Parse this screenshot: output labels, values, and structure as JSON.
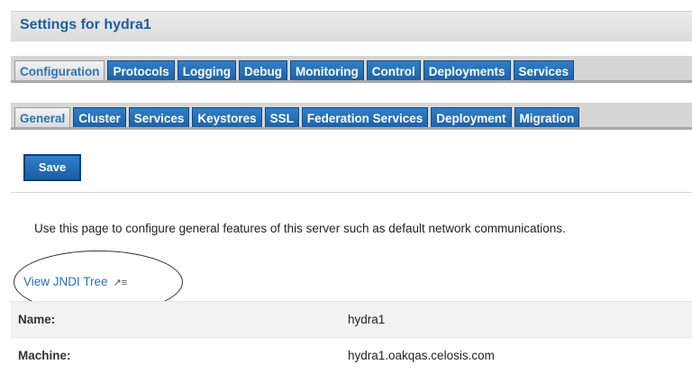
{
  "header": {
    "title": "Settings for hydra1"
  },
  "primary_tabs": [
    {
      "label": "Configuration",
      "selected": true
    },
    {
      "label": "Protocols",
      "selected": false
    },
    {
      "label": "Logging",
      "selected": false
    },
    {
      "label": "Debug",
      "selected": false
    },
    {
      "label": "Monitoring",
      "selected": false
    },
    {
      "label": "Control",
      "selected": false
    },
    {
      "label": "Deployments",
      "selected": false
    },
    {
      "label": "Services",
      "selected": false
    }
  ],
  "secondary_tabs": [
    {
      "label": "General",
      "selected": true
    },
    {
      "label": "Cluster",
      "selected": false
    },
    {
      "label": "Services",
      "selected": false
    },
    {
      "label": "Keystores",
      "selected": false
    },
    {
      "label": "SSL",
      "selected": false
    },
    {
      "label": "Federation Services",
      "selected": false
    },
    {
      "label": "Deployment",
      "selected": false
    },
    {
      "label": "Migration",
      "selected": false
    }
  ],
  "toolbar": {
    "save_label": "Save"
  },
  "description": "Use this page to configure general features of this server such as default network communications.",
  "jndi_link": {
    "label": "View JNDI Tree",
    "icon": "popout-icon"
  },
  "properties": [
    {
      "label": "Name:",
      "value": "hydra1"
    },
    {
      "label": "Machine:",
      "value": "hydra1.oakqas.celosis.com"
    }
  ],
  "colors": {
    "tab_blue": "#1e5fa3",
    "title_blue": "#1f5f9e",
    "link_blue": "#2a6fb8"
  }
}
